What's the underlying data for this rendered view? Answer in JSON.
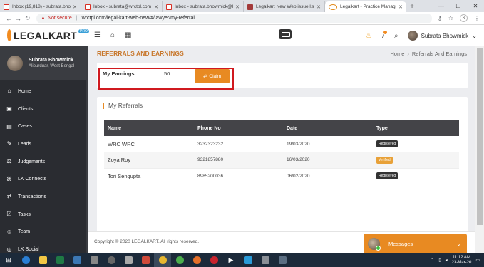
{
  "browser": {
    "tabs": [
      {
        "label": "Inbox (19,818) - subrata.bhowmick...",
        "icon": "gmail"
      },
      {
        "label": "Inbox - subrata@wrctpl.com - Wi...",
        "icon": "gmail"
      },
      {
        "label": "Inbox - subrata.bhowmick@leg...",
        "icon": "gmail"
      },
      {
        "label": "Legalkart New Web issue list b...",
        "icon": "doc"
      },
      {
        "label": "Legalkart - Practice Manageme...",
        "icon": "logo",
        "active": true
      }
    ],
    "new_tab": "+",
    "window_controls": [
      "—",
      "☐",
      "✕"
    ],
    "address": {
      "security_text": "Not secure",
      "url": "wrctpl.com/legal-kart-web-new/#/lawyer/my-referral"
    },
    "profile_initial": "S"
  },
  "header": {
    "logo_text": "LEGALKART",
    "logo_badge": "PRO",
    "user_name": "Subrata Bhowmick"
  },
  "sidebar": {
    "profile_name": "Subrata Bhowmick",
    "profile_location": "Alipurduar, West Bengal",
    "items": [
      {
        "label": "Home",
        "icon": "home-icon",
        "glyph": "⌂"
      },
      {
        "label": "Clients",
        "icon": "clients-icon",
        "glyph": "▣"
      },
      {
        "label": "Cases",
        "icon": "cases-icon",
        "glyph": "▤"
      },
      {
        "label": "Leads",
        "icon": "leads-icon",
        "glyph": "✎"
      },
      {
        "label": "Judgements",
        "icon": "judgements-icon",
        "glyph": "⚖"
      },
      {
        "label": "LK Connects",
        "icon": "connects-icon",
        "glyph": "⌘"
      },
      {
        "label": "Transactions",
        "icon": "transactions-icon",
        "glyph": "⇄"
      },
      {
        "label": "Tasks",
        "icon": "tasks-icon",
        "glyph": "☑"
      },
      {
        "label": "Team",
        "icon": "team-icon",
        "glyph": "☺"
      },
      {
        "label": "LK Social",
        "icon": "social-icon",
        "glyph": "◎"
      }
    ]
  },
  "page": {
    "title": "REFERRALS AND EARNINGS",
    "breadcrumb": {
      "home": "Home",
      "separator": "›",
      "current": "Referrals And Earnings"
    }
  },
  "earnings": {
    "label": "My Earnings",
    "value": "50",
    "claim_label": "Claim"
  },
  "referrals": {
    "title": "My Referrals",
    "columns": [
      "Name",
      "Phone No",
      "Date",
      "Type"
    ],
    "rows": [
      {
        "name": "WRC WRC",
        "phone": "3232323232",
        "date": "19/03/2020",
        "type": "Registered"
      },
      {
        "name": "Zoya Roy",
        "phone": "9321857880",
        "date": "16/03/2020",
        "type": "Verified"
      },
      {
        "name": "Tori Sengupta",
        "phone": "8985200036",
        "date": "06/02/2020",
        "type": "Registered"
      }
    ]
  },
  "footer": {
    "copyright": "Copyright © 2020 LEGALKART. All rights reserved."
  },
  "messages": {
    "label": "Messages"
  },
  "taskbar": {
    "time": "11:12 AM",
    "date": "23-Mar-20"
  },
  "colors": {
    "accent": "#e88a22",
    "sidebar": "#2a2c31",
    "highlight_box": "#d0191f"
  }
}
